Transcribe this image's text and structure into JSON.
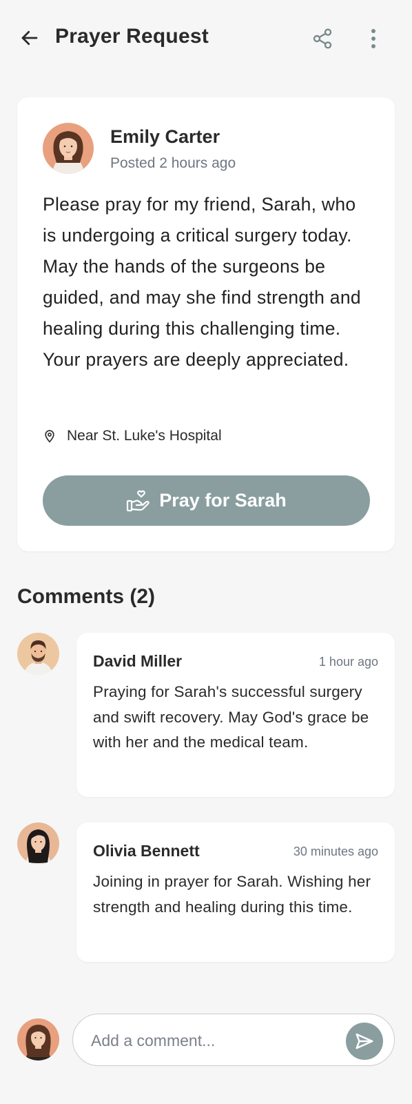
{
  "header": {
    "title": "Prayer Request",
    "icons": [
      "arrow-left-icon",
      "share-icon",
      "more-vertical-icon"
    ]
  },
  "post": {
    "author": "Emily Carter",
    "posted": "Posted 2 hours ago",
    "body": "Please pray for my friend, Sarah, who is undergoing a critical surgery today. May the hands of the surgeons be guided, and may she find strength and healing during this challenging time. Your prayers are deeply appreciated.",
    "location": "Near St. Luke's Hospital",
    "pray_button": "Pray for Sarah"
  },
  "comments": {
    "title": "Comments (2)",
    "items": [
      {
        "name": "David Miller",
        "time": "1 hour ago",
        "text": "Praying for Sarah's successful surgery and swift recovery. May God's grace be with her and the medical team."
      },
      {
        "name": "Olivia Bennett",
        "time": "30 minutes ago",
        "text": "Joining in prayer for Sarah. Wishing her strength and healing during this time."
      }
    ]
  },
  "composer": {
    "placeholder": "Add a comment..."
  },
  "colors": {
    "accent": "#8a9ea0",
    "background": "#f6f6f6",
    "card": "#ffffff",
    "muted_text": "#6e7681"
  }
}
